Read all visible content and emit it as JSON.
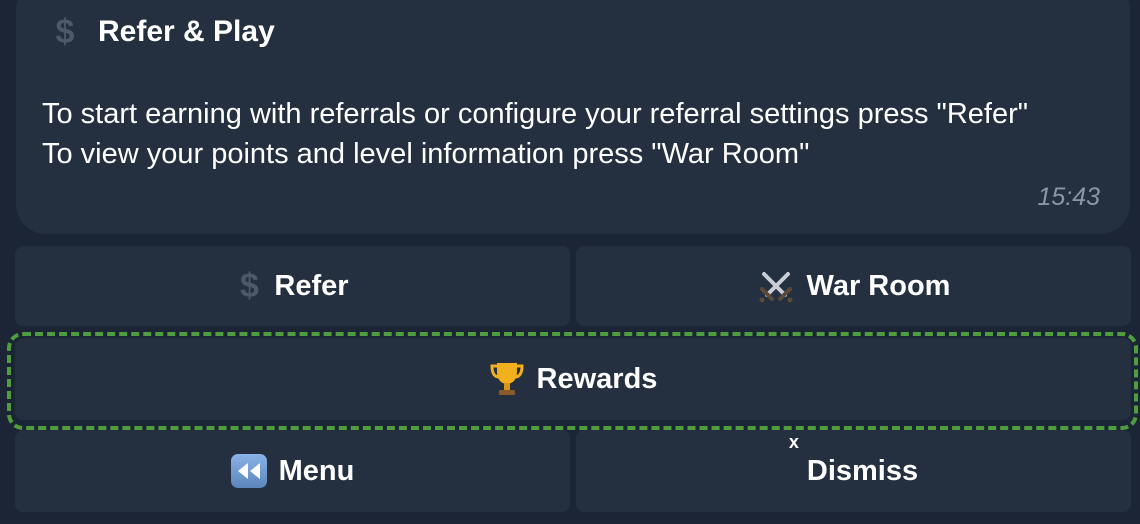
{
  "message": {
    "header_icon": "dollar-icon",
    "title": "Refer & Play",
    "body": "To start earning with referrals or configure your referral settings press \"Refer\"\nTo view your points and level information press \"War Room\"",
    "time": "15:43"
  },
  "keyboard": {
    "refer": {
      "label": "Refer",
      "icon": "dollar-icon"
    },
    "war_room": {
      "label": "War Room",
      "icon": "crossed-swords-icon"
    },
    "rewards": {
      "label": "Rewards",
      "icon": "trophy-icon"
    },
    "menu": {
      "label": "Menu",
      "icon": "rewind-icon"
    },
    "dismiss": {
      "label": "Dismiss",
      "icon": "x-icon",
      "icon_glyph": "x"
    }
  },
  "colors": {
    "background": "#1b2535",
    "bubble": "#24303f",
    "highlight": "#4f9e3d",
    "muted_text": "#8a96a6"
  }
}
